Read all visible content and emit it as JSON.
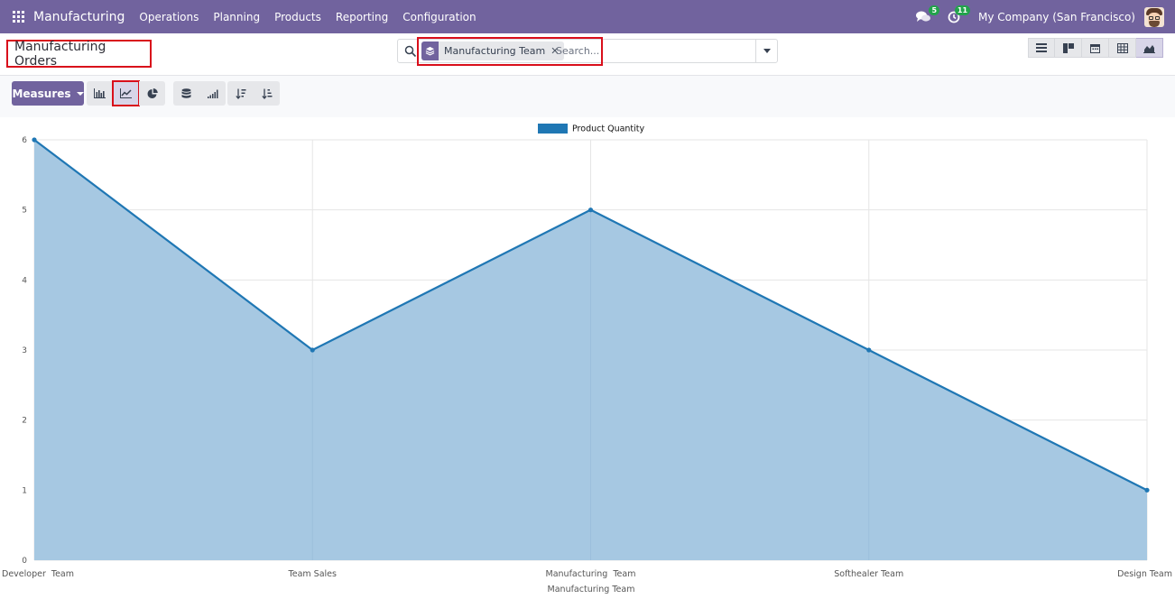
{
  "navbar": {
    "app_name": "Manufacturing",
    "menu": [
      "Operations",
      "Planning",
      "Products",
      "Reporting",
      "Configuration"
    ],
    "messages_count": "5",
    "activities_count": "11",
    "company": "My Company (San Francisco)"
  },
  "breadcrumb": {
    "title": "Manufacturing Orders"
  },
  "search": {
    "facet_label": "Manufacturing Team",
    "placeholder": "Search..."
  },
  "toolbar": {
    "measures_label": "Measures"
  },
  "colors": {
    "navbar": "#71639e",
    "series_line": "#1f77b4",
    "series_fill": "#a6c8e2",
    "highlight": "#d90f1b"
  },
  "chart_data": {
    "type": "area",
    "categories": [
      "Developer  Team",
      "Team Sales",
      "Manufacturing  Team",
      "Softhealer Team",
      "Design Team"
    ],
    "series": [
      {
        "name": "Product Quantity",
        "values": [
          6,
          3,
          5,
          3,
          1
        ]
      }
    ],
    "xlabel": "Manufacturing Team",
    "ylabel": "",
    "ylim": [
      0,
      6
    ],
    "yticks": [
      0,
      1,
      2,
      3,
      4,
      5,
      6
    ],
    "grid": true,
    "legend": "top-center"
  }
}
